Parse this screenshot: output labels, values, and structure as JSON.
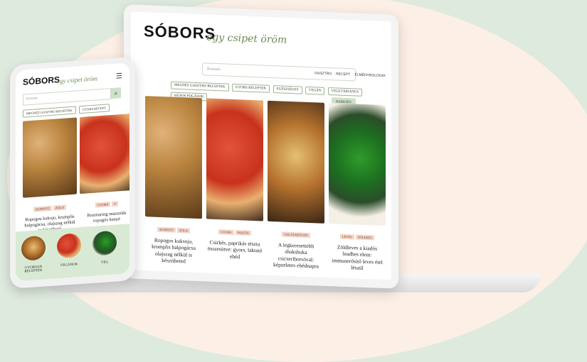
{
  "site": {
    "logo": "SÓBORS",
    "tagline": "egy csipet öröm"
  },
  "nav": {
    "items": [
      "GASZTRO",
      "RECEPT",
      "ÉLMÉNYBOLOGIA"
    ]
  },
  "search": {
    "placeholder": "Keresés",
    "button_label": "KERESÉS"
  },
  "chips": [
    "MEGNÉZ GASZTRO RECEPTEK",
    "GYORS RECEPTEK",
    "EGÉSZSÉGES",
    "VEGÁN",
    "VEGETÁRIÁNUS",
    "HÚSOS FOGÁSOK"
  ],
  "cards": [
    {
      "badges": [
        "KONNYŰ",
        "ZÖLD"
      ],
      "title": "Ropogos kuksoju, krumplis halpogácsa olajszag nélkül is készítheted"
    },
    {
      "badges": [
        "GYORS",
        "PASZTA"
      ],
      "title": "Csirkés, paprikás tészta összesütve: gyors, laktató ebéd"
    },
    {
      "badges": [
        "SALÁTAKÜLÖN"
      ],
      "title": "A legkeresettebb shakshuka csicseriborsóval: képzeletes ebédnapra"
    },
    {
      "badges": [
        "LEVES",
        "ZÖLDSÉG"
      ],
      "title": "Zöldleves a kiadós leadhes elem: immunerősítő leves étel lészül"
    }
  ],
  "phone": {
    "search_placeholder": "Keresés",
    "search_icon": "search-icon",
    "menu_icon": "hamburger-icon",
    "chips": [
      "MEGNÉZ GASZTRO RECEPTEK",
      "GYORS RECEPT"
    ],
    "cards": [
      {
        "badges": [
          "KONNYŰ",
          "ZÖLD"
        ],
        "title": "Ropogos kukoju, krumplis halpogácsa, olajszag nélkül is készíthető"
      },
      {
        "badges": [
          "GYORS",
          "P"
        ],
        "title": "Rozmaring-mazsolás ropogós kenyé"
      }
    ],
    "bottom": [
      "GYORSAN RECEPTEK",
      "VEGÁNOK",
      "VEG"
    ]
  },
  "colors": {
    "accent": "#6a8a55",
    "search_button": "#cfe1c8",
    "badge": "#f4d6c8",
    "bottom_band": "#d9ead4"
  }
}
